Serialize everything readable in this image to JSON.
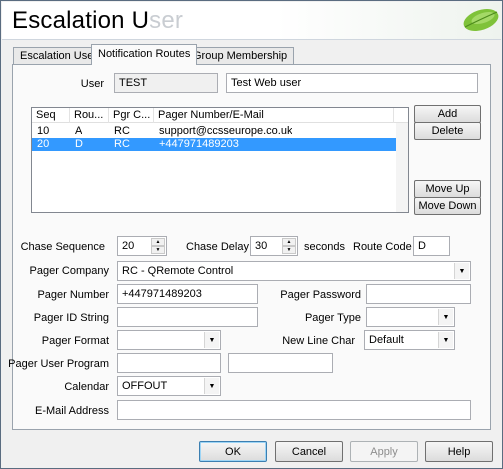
{
  "banner": {
    "title_main": "Escalation U",
    "title_ghost": "ser"
  },
  "tabs": [
    {
      "label": "Escalation User"
    },
    {
      "label": "Notification Routes"
    },
    {
      "label": "Group Membership"
    }
  ],
  "user": {
    "label": "User",
    "id": "TEST",
    "name": "Test Web user"
  },
  "routes": {
    "columns": [
      "Seq",
      "Rou...",
      "Pgr C...",
      "Pager Number/E-Mail"
    ],
    "rows": [
      {
        "seq": "10",
        "route": "A",
        "pager_company": "RC",
        "contact": "support@ccsseurope.co.uk",
        "selected": false
      },
      {
        "seq": "20",
        "route": "D",
        "pager_company": "RC",
        "contact": "+447971489203",
        "selected": true
      }
    ]
  },
  "buttons": {
    "add": "Add",
    "delete": "Delete",
    "move_up": "Move Up",
    "move_down": "Move Down"
  },
  "form": {
    "chase_sequence_label": "Chase Sequence",
    "chase_sequence": "20",
    "chase_delay_label": "Chase Delay",
    "chase_delay": "30",
    "seconds_label": "seconds",
    "route_code_label": "Route Code",
    "route_code": "D",
    "pager_company_label": "Pager Company",
    "pager_company": "RC - QRemote Control",
    "pager_number_label": "Pager Number",
    "pager_number": "+447971489203",
    "pager_password_label": "Pager Password",
    "pager_password": "",
    "pager_id_label": "Pager ID String",
    "pager_id": "",
    "pager_type_label": "Pager Type",
    "pager_type": "",
    "pager_format_label": "Pager Format",
    "pager_format": "",
    "new_line_char_label": "New Line Char",
    "new_line_char": "Default",
    "pager_user_program_label": "Pager User Program",
    "pager_user_program": "",
    "pager_user_program_2": "",
    "calendar_label": "Calendar",
    "calendar": "OFFOUT",
    "email_label": "E-Mail Address",
    "email": ""
  },
  "dialog": {
    "ok": "OK",
    "cancel": "Cancel",
    "apply": "Apply",
    "help": "Help"
  }
}
